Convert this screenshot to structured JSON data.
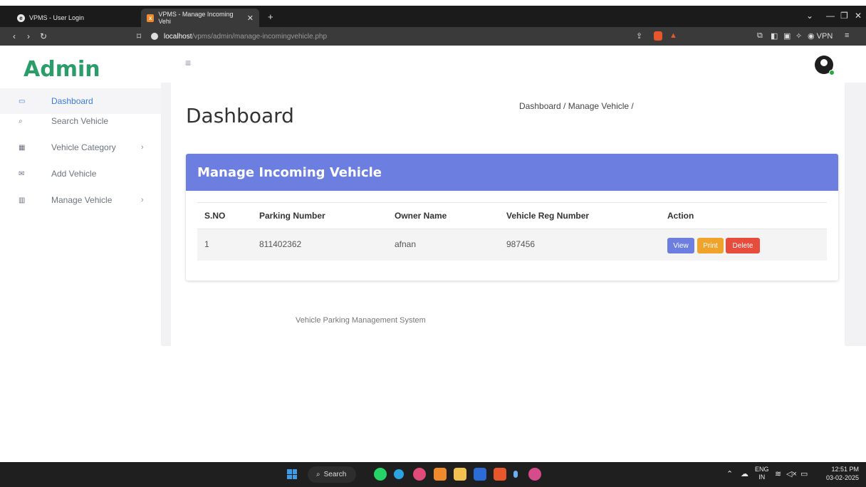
{
  "browser": {
    "tabs": [
      {
        "title": "VPMS - User Login",
        "icon": "edge-icon",
        "active": false
      },
      {
        "title": "VPMS - Manage Incoming Vehi",
        "icon": "xampp-icon",
        "active": true
      }
    ],
    "new_tab_label": "+",
    "url_host": "localhost",
    "url_path": "/vpms/admin/manage-incomingvehicle.php",
    "vpn_label": "VPN"
  },
  "sidebar": {
    "logo": "Admin",
    "items": [
      {
        "label": "Dashboard",
        "icon": "laptop-icon",
        "active": true,
        "has_children": false
      },
      {
        "label": "Search Vehicle",
        "icon": "search-icon",
        "active": false,
        "has_children": false
      },
      {
        "label": "Vehicle Category",
        "icon": "grid-icon",
        "active": false,
        "has_children": true
      },
      {
        "label": "Add Vehicle",
        "icon": "mail-icon",
        "active": false,
        "has_children": false
      },
      {
        "label": "Manage Vehicle",
        "icon": "apps-icon",
        "active": false,
        "has_children": true
      }
    ]
  },
  "header": {
    "menu_icon": "hamburger-icon",
    "avatar_icon": "user-icon"
  },
  "main": {
    "page_title": "Dashboard",
    "breadcrumb": "Dashboard / Manage Vehicle /",
    "card_title": "Manage Incoming Vehicle",
    "table": {
      "headers": [
        "S.NO",
        "Parking Number",
        "Owner Name",
        "Vehicle Reg Number",
        "Action"
      ],
      "rows": [
        {
          "sno": "1",
          "parking_number": "811402362",
          "owner_name": "afnan",
          "vehicle_reg": "987456"
        }
      ],
      "actions": {
        "view": "View",
        "print": "Print",
        "delete": "Delete"
      }
    },
    "footer": "Vehicle Parking Management System"
  },
  "taskbar": {
    "search_label": "Search",
    "lang_top": "ENG",
    "lang_bottom": "IN",
    "time": "12:51 PM",
    "date": "03-02-2025"
  },
  "colors": {
    "accent": "#6c7fe0",
    "logo": "#2a9d6a",
    "view_button": "#6c7fe0",
    "print_button": "#f0a32a",
    "delete_button": "#e74c3c"
  }
}
